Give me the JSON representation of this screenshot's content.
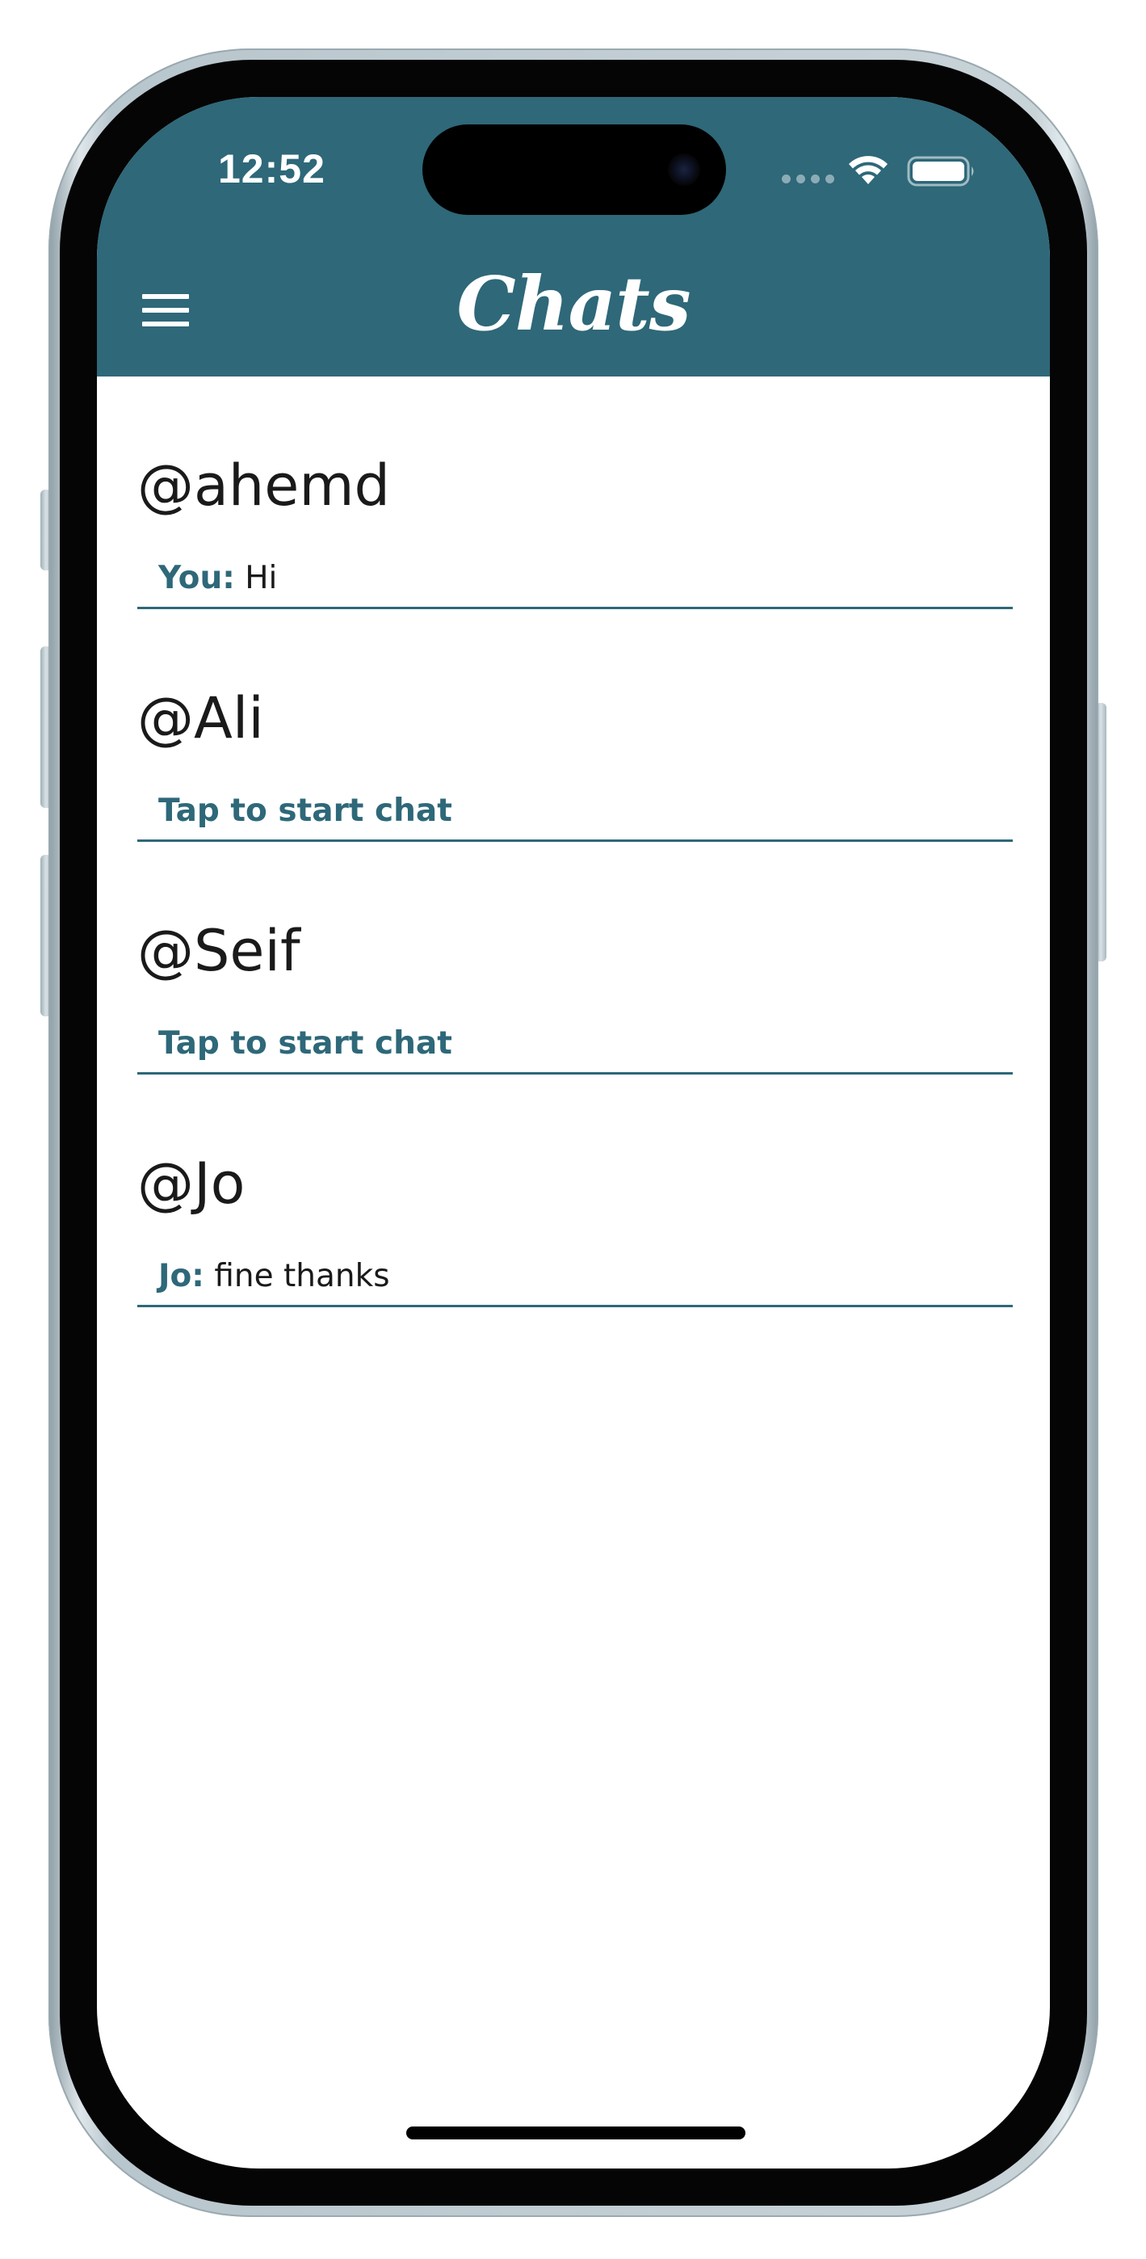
{
  "status_bar": {
    "time": "12:52"
  },
  "header": {
    "title": "Chats",
    "menu_icon": "hamburger-menu-icon",
    "background_color": "#2e6879"
  },
  "chats": [
    {
      "username": "@ahemd",
      "sender": "You:",
      "message": "Hi",
      "cta": ""
    },
    {
      "username": "@Ali",
      "sender": "",
      "message": "",
      "cta": "Tap to start chat"
    },
    {
      "username": "@Seif",
      "sender": "",
      "message": "",
      "cta": "Tap to start chat"
    },
    {
      "username": "@Jo",
      "sender": "Jo:",
      "message": "fine thanks",
      "cta": ""
    }
  ],
  "colors": {
    "accent": "#2e6879",
    "text": "#1a1a1a",
    "background": "#ffffff"
  }
}
